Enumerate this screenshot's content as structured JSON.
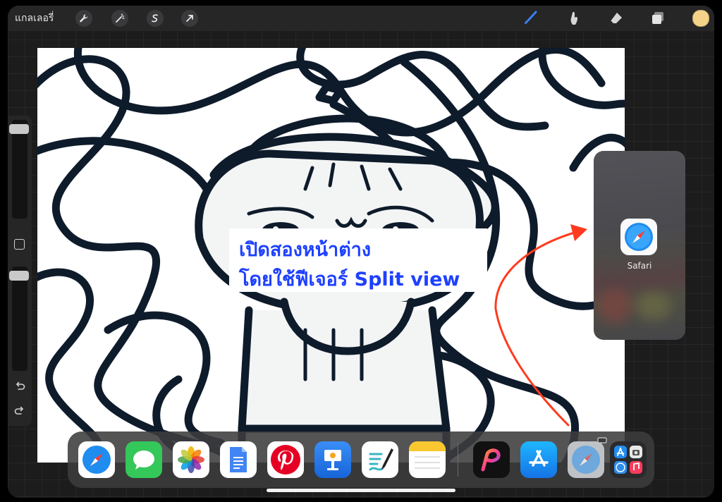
{
  "toolbar": {
    "gallery_label": "แกลเลอรี่",
    "left_tools": [
      "wrench-icon",
      "magic-wand-icon",
      "selection-icon",
      "transform-arrow-icon"
    ],
    "right_tools": [
      "brush-icon",
      "smudge-icon",
      "eraser-icon",
      "layers-icon"
    ],
    "current_color": "#f4d389",
    "accent_color": "#3c7ff5"
  },
  "sidebar": {
    "tools": [
      "brush-size-slider",
      "modify-button",
      "opacity-slider",
      "undo-icon",
      "redo-icon"
    ]
  },
  "caption": {
    "line1": "เปิดสองหน้าต่าง",
    "line2": "โดยใช้ฟีเจอร์ Split view",
    "color": "#1e40ff"
  },
  "slide_over": {
    "app_label": "Safari",
    "arrow_color": "#ff3b1f"
  },
  "dock": {
    "apps": [
      "Safari",
      "Messages",
      "Photos",
      "Google Docs",
      "Pinterest",
      "Keynote",
      "Notability",
      "Notes",
      "Procreate",
      "App Store",
      "Safari",
      "App Library"
    ]
  }
}
